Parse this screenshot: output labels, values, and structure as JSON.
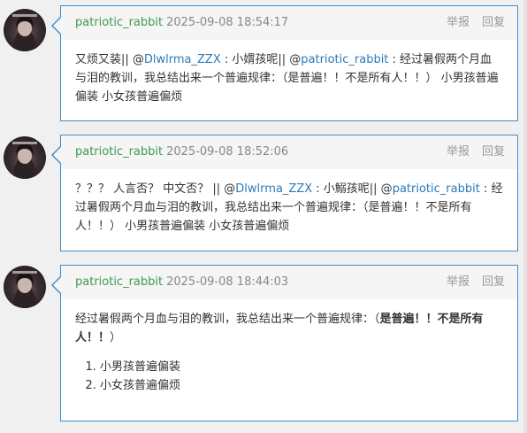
{
  "comments": [
    {
      "author": "patriotic_rabbit",
      "date": "2025-09-08 18:54:17",
      "report_label": "举报",
      "reply_label": "回复",
      "parts": [
        {
          "t": "又烦又装|| @"
        },
        {
          "t": "Dlwlrma_ZZX",
          "mention": true
        },
        {
          "t": " : 小媦孩呢|| @"
        },
        {
          "t": "patriotic_rabbit",
          "mention": true
        },
        {
          "t": " : 经过暑假两个月血与泪的教训，我总结出来一个普遍规律：（是普遍！！不是所有人！！） 小男孩普遍偏装 小女孩普遍偏烦"
        }
      ]
    },
    {
      "author": "patriotic_rabbit",
      "date": "2025-09-08 18:52:06",
      "report_label": "举报",
      "reply_label": "回复",
      "parts": [
        {
          "t": "？？？ 人言否？ 中文否？ || @"
        },
        {
          "t": "Dlwlrma_ZZX",
          "mention": true
        },
        {
          "t": " : 小鰯孩呢|| @"
        },
        {
          "t": "patriotic_rabbit",
          "mention": true
        },
        {
          "t": " : 经过暑假两个月血与泪的教训，我总结出来一个普遍规律：（是普遍！！不是所有人！！） 小男孩普遍偏装 小女孩普遍偏烦"
        }
      ]
    },
    {
      "author": "patriotic_rabbit",
      "date": "2025-09-08 18:44:03",
      "report_label": "举报",
      "reply_label": "回复",
      "text_plain": "经过暑假两个月血与泪的教训，我总结出来一个普遍规律：（",
      "text_bold": "是普遍！！不是所有人！！",
      "text_end": "）",
      "list": [
        "小男孩普遍偏装",
        "小女孩普遍偏烦"
      ]
    }
  ]
}
